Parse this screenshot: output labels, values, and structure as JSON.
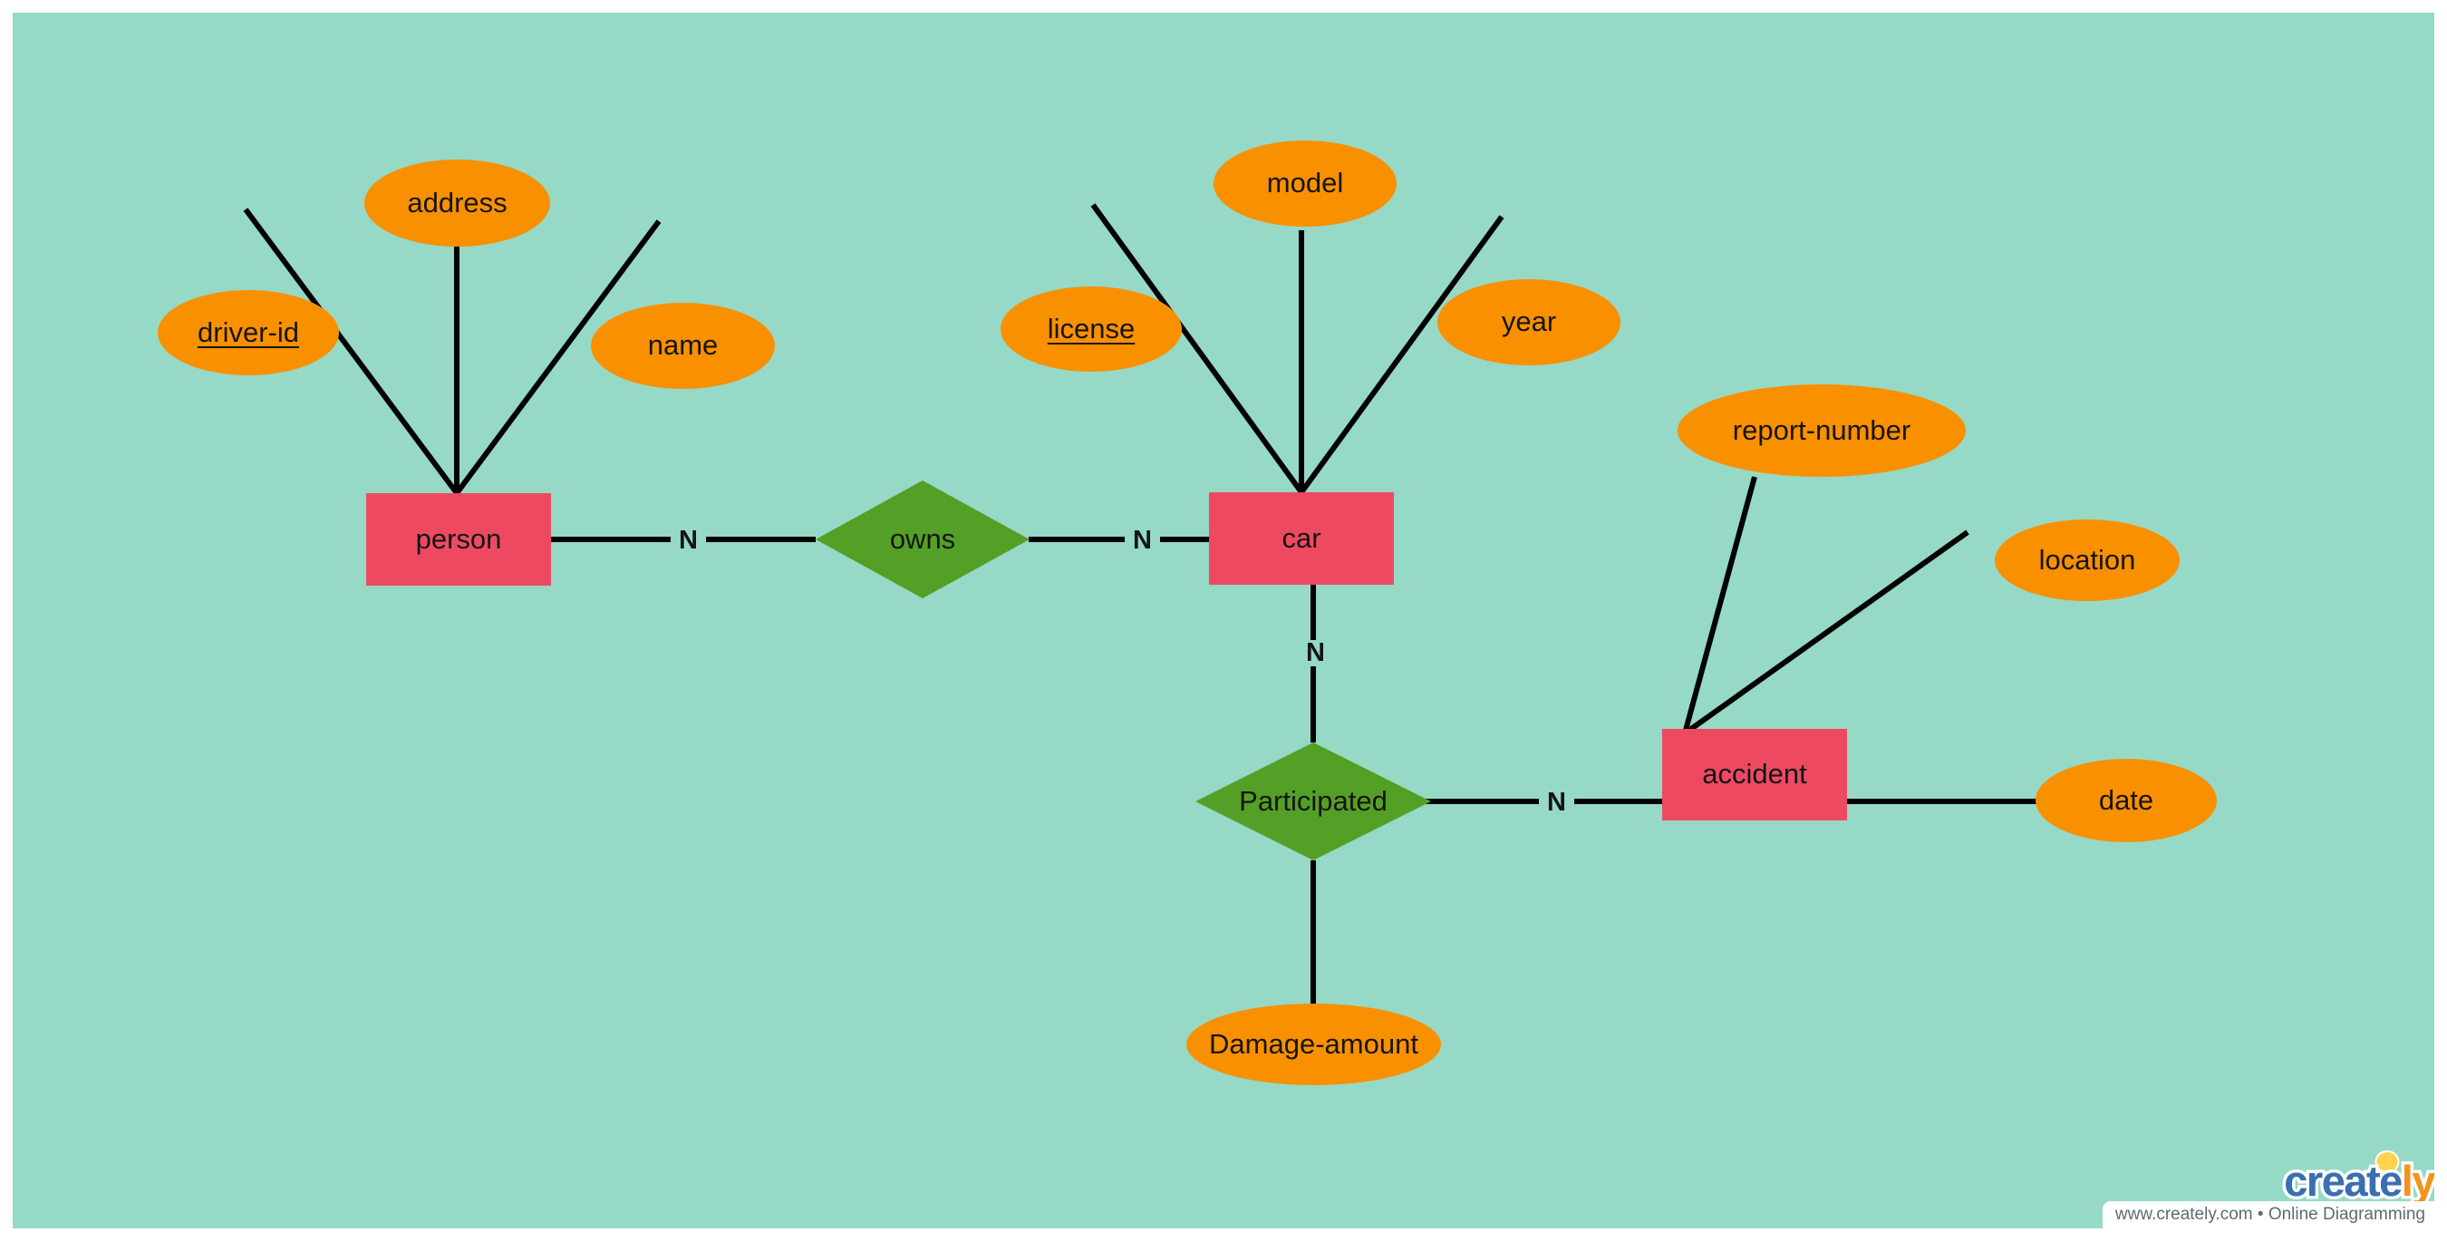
{
  "canvas": {
    "background_color": "#96D9C7",
    "page_background_color": "#ffffff"
  },
  "palette": {
    "entity_fill": "#ED4A62",
    "attribute_fill": "#F99000",
    "relationship_fill": "#54A027",
    "line_color": "#000000",
    "text_color": "#151515"
  },
  "diagram": {
    "type": "er-diagram",
    "entities": [
      {
        "id": "person",
        "label": "person"
      },
      {
        "id": "car",
        "label": "car"
      },
      {
        "id": "accident",
        "label": "accident"
      }
    ],
    "relationships": [
      {
        "id": "owns",
        "label": "owns"
      },
      {
        "id": "participated",
        "label": "Participated"
      }
    ],
    "attributes": [
      {
        "id": "driver-id",
        "label": "driver-id",
        "primary_key": true,
        "owner": "person"
      },
      {
        "id": "address",
        "label": "address",
        "primary_key": false,
        "owner": "person"
      },
      {
        "id": "name",
        "label": "name",
        "primary_key": false,
        "owner": "person"
      },
      {
        "id": "license",
        "label": "license",
        "primary_key": true,
        "owner": "car"
      },
      {
        "id": "model",
        "label": "model",
        "primary_key": false,
        "owner": "car"
      },
      {
        "id": "year",
        "label": "year",
        "primary_key": false,
        "owner": "car"
      },
      {
        "id": "report-number",
        "label": "report-number",
        "primary_key": false,
        "owner": "accident"
      },
      {
        "id": "location",
        "label": "location",
        "primary_key": false,
        "owner": "accident"
      },
      {
        "id": "date",
        "label": "date",
        "primary_key": false,
        "owner": "accident"
      },
      {
        "id": "damage-amount",
        "label": "Damage-amount",
        "primary_key": false,
        "owner": "participated"
      }
    ],
    "cardinalities": [
      {
        "id": "person-owns",
        "from": "person",
        "to": "owns",
        "label": "N"
      },
      {
        "id": "owns-car",
        "from": "owns",
        "to": "car",
        "label": "N"
      },
      {
        "id": "car-participated",
        "from": "car",
        "to": "participated",
        "label": "N"
      },
      {
        "id": "participated-accident",
        "from": "participated",
        "to": "accident",
        "label": "N"
      }
    ]
  },
  "watermark": {
    "logo_part1": "create",
    "logo_part2": "ly",
    "tagline": "www.creately.com • Online Diagramming"
  }
}
